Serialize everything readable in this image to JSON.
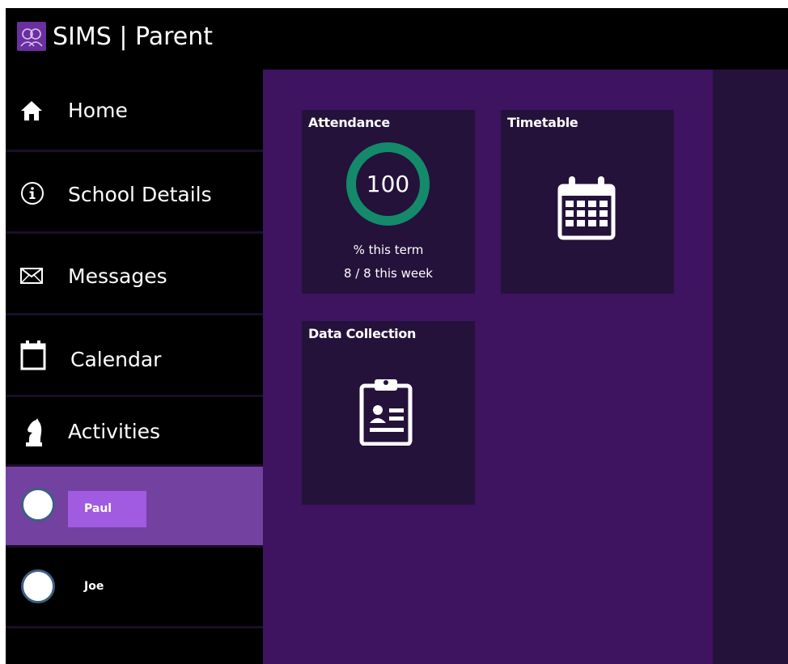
{
  "app": {
    "title": "SIMS | Parent"
  },
  "sidebar": {
    "items": [
      {
        "label": "Home",
        "icon": "home-icon"
      },
      {
        "label": "School Details",
        "icon": "info-icon"
      },
      {
        "label": "Messages",
        "icon": "envelope-icon"
      },
      {
        "label": "Calendar",
        "icon": "calendar-icon"
      },
      {
        "label": "Activities",
        "icon": "chess-knight-icon"
      }
    ],
    "children": [
      {
        "name": "Paul",
        "selected": true
      },
      {
        "name": "Joe",
        "selected": false
      }
    ]
  },
  "tiles": {
    "attendance": {
      "title": "Attendance",
      "value": "100",
      "term_label": "% this term",
      "week_label": "8 / 8 this week"
    },
    "timetable": {
      "title": "Timetable",
      "icon": "timetable-calendar-icon"
    },
    "data_collection": {
      "title": "Data Collection",
      "icon": "clipboard-icon"
    }
  },
  "colors": {
    "topbar": "#000000",
    "sidebar": "#000000",
    "selected_child": "#7341a0",
    "child_name_badge": "#a05be0",
    "main_bg": "#3e1360",
    "tile_bg": "#24123b",
    "ring": "#148a6b"
  }
}
